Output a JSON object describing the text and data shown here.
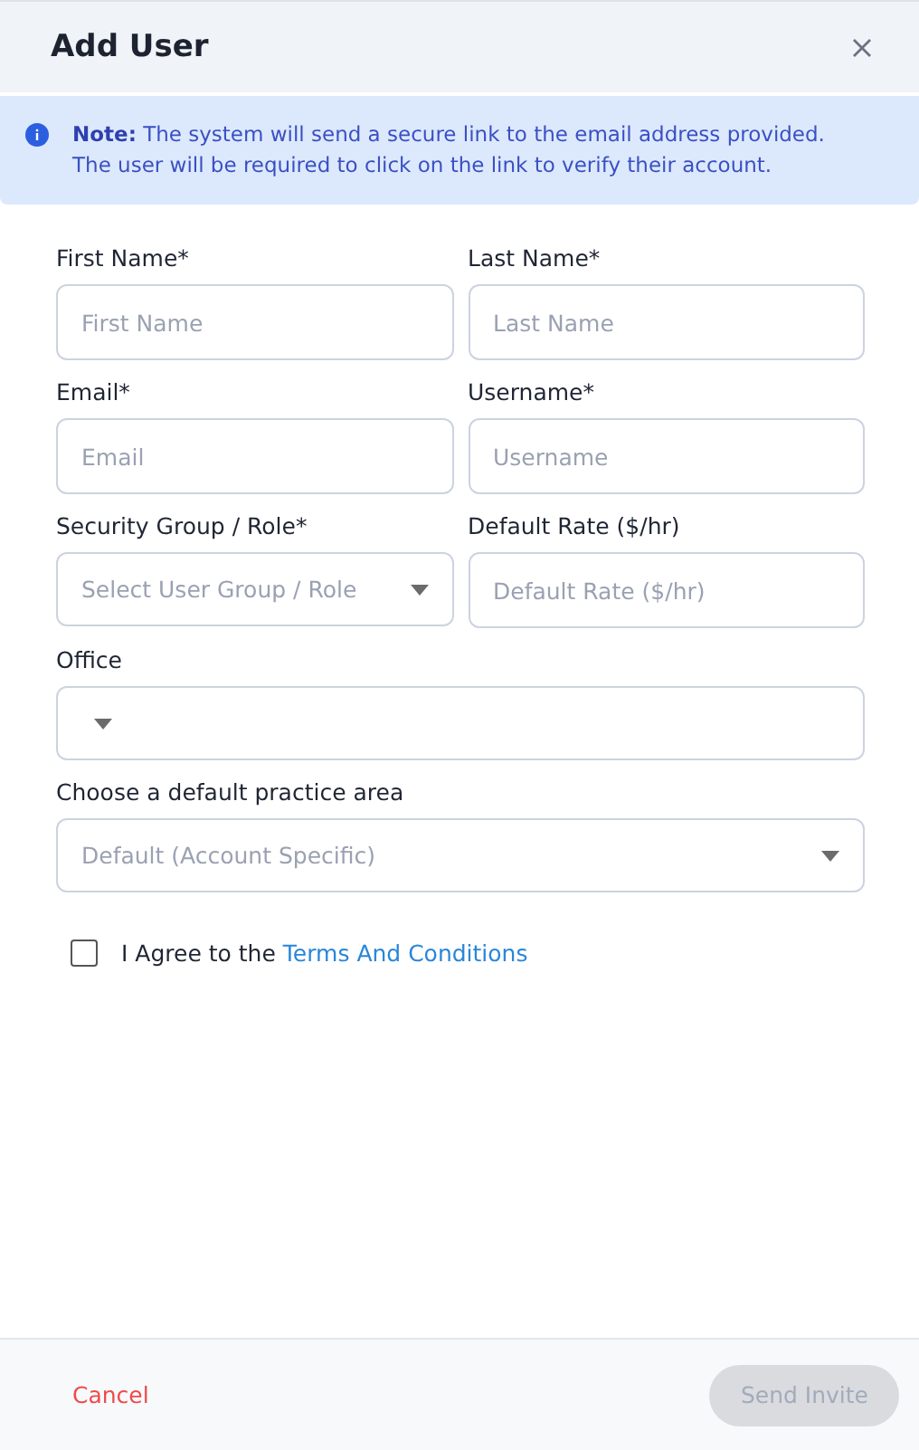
{
  "dialog": {
    "title": "Add User"
  },
  "note": {
    "text": "**Note:** The system will send a secure link to the email address provided.\nThe user will be required to click on the link to verify their account."
  },
  "rows": [
    {
      "fields": [
        {
          "label": "First Name*",
          "kind": "text",
          "placeholder": "First Name"
        },
        {
          "label": "Last Name*",
          "kind": "text",
          "placeholder": "Last Name"
        }
      ]
    },
    {
      "fields": [
        {
          "label": "Email*",
          "kind": "text",
          "placeholder": "Email"
        },
        {
          "label": "Username*",
          "kind": "text",
          "placeholder": "Username"
        }
      ]
    },
    {
      "fields": [
        {
          "label": "Security Group / Role*",
          "kind": "select",
          "placeholder": "Select User Group / Role"
        },
        {
          "label": "Default Rate ($/hr)",
          "kind": "text",
          "placeholder": "Default Rate ($/hr)"
        }
      ]
    },
    {
      "fields": [
        {
          "label": "Office",
          "kind": "select-empty"
        }
      ]
    },
    {
      "fields": [
        {
          "label": "Choose a default practice area",
          "kind": "select",
          "placeholder": "Default (Account Specific)"
        }
      ]
    }
  ],
  "agreement": {
    "checked": false,
    "text": "I Agree to the",
    "link": "Terms And Conditions"
  },
  "footer": {
    "cancel": "Cancel",
    "submit": {
      "label": "Send Invite",
      "disabled": true
    }
  }
}
